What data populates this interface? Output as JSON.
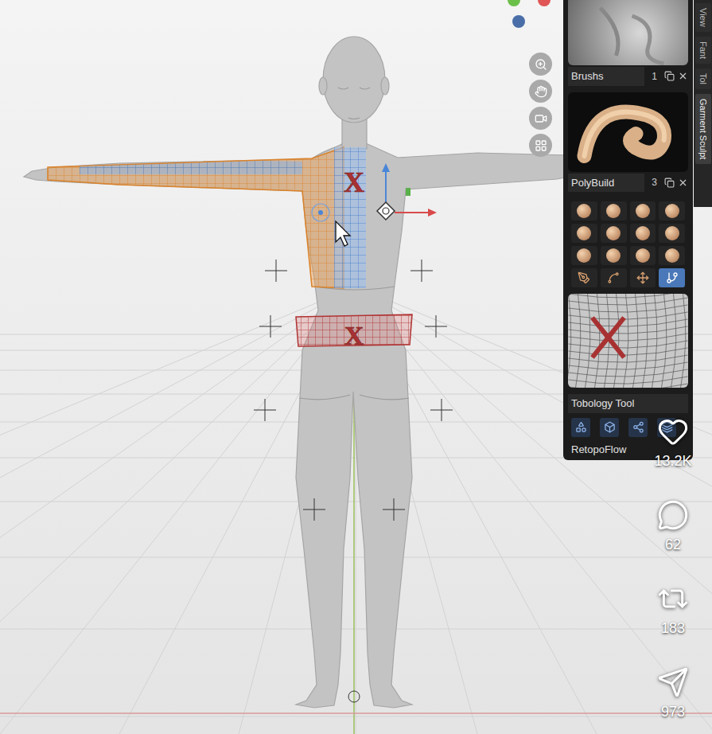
{
  "viewport": {
    "markers": [
      "X",
      "X"
    ]
  },
  "side_tabs": [
    {
      "label": "View",
      "selected": false
    },
    {
      "label": "Fant",
      "selected": false
    },
    {
      "label": "Tol",
      "selected": false
    },
    {
      "label": "Garment Sculpt",
      "selected": true
    }
  ],
  "panels": [
    {
      "name": "Brushs",
      "count": "1"
    },
    {
      "name": "PolyBuild",
      "count": "3"
    }
  ],
  "tools": [
    {
      "kind": "sphere",
      "selected": false
    },
    {
      "kind": "sphere",
      "selected": false
    },
    {
      "kind": "sphere",
      "selected": false
    },
    {
      "kind": "sphere",
      "selected": false
    },
    {
      "kind": "sphere",
      "selected": false
    },
    {
      "kind": "sphere",
      "selected": false
    },
    {
      "kind": "sphere",
      "selected": false
    },
    {
      "kind": "sphere",
      "selected": false
    },
    {
      "kind": "sphere",
      "selected": false
    },
    {
      "kind": "sphere",
      "selected": false
    },
    {
      "kind": "sphere",
      "selected": false
    },
    {
      "kind": "sphere",
      "selected": false
    },
    {
      "kind": "line",
      "selected": false
    },
    {
      "kind": "line",
      "selected": false
    },
    {
      "kind": "line",
      "selected": false
    },
    {
      "kind": "line",
      "selected": true
    }
  ],
  "topology": {
    "title": "Tobology Tool",
    "addon": "RetopoFlow"
  },
  "social": [
    {
      "kind": "like",
      "count": "13.2K"
    },
    {
      "kind": "comment",
      "count": "62"
    },
    {
      "kind": "repost",
      "count": "183"
    },
    {
      "kind": "share",
      "count": "973"
    }
  ]
}
